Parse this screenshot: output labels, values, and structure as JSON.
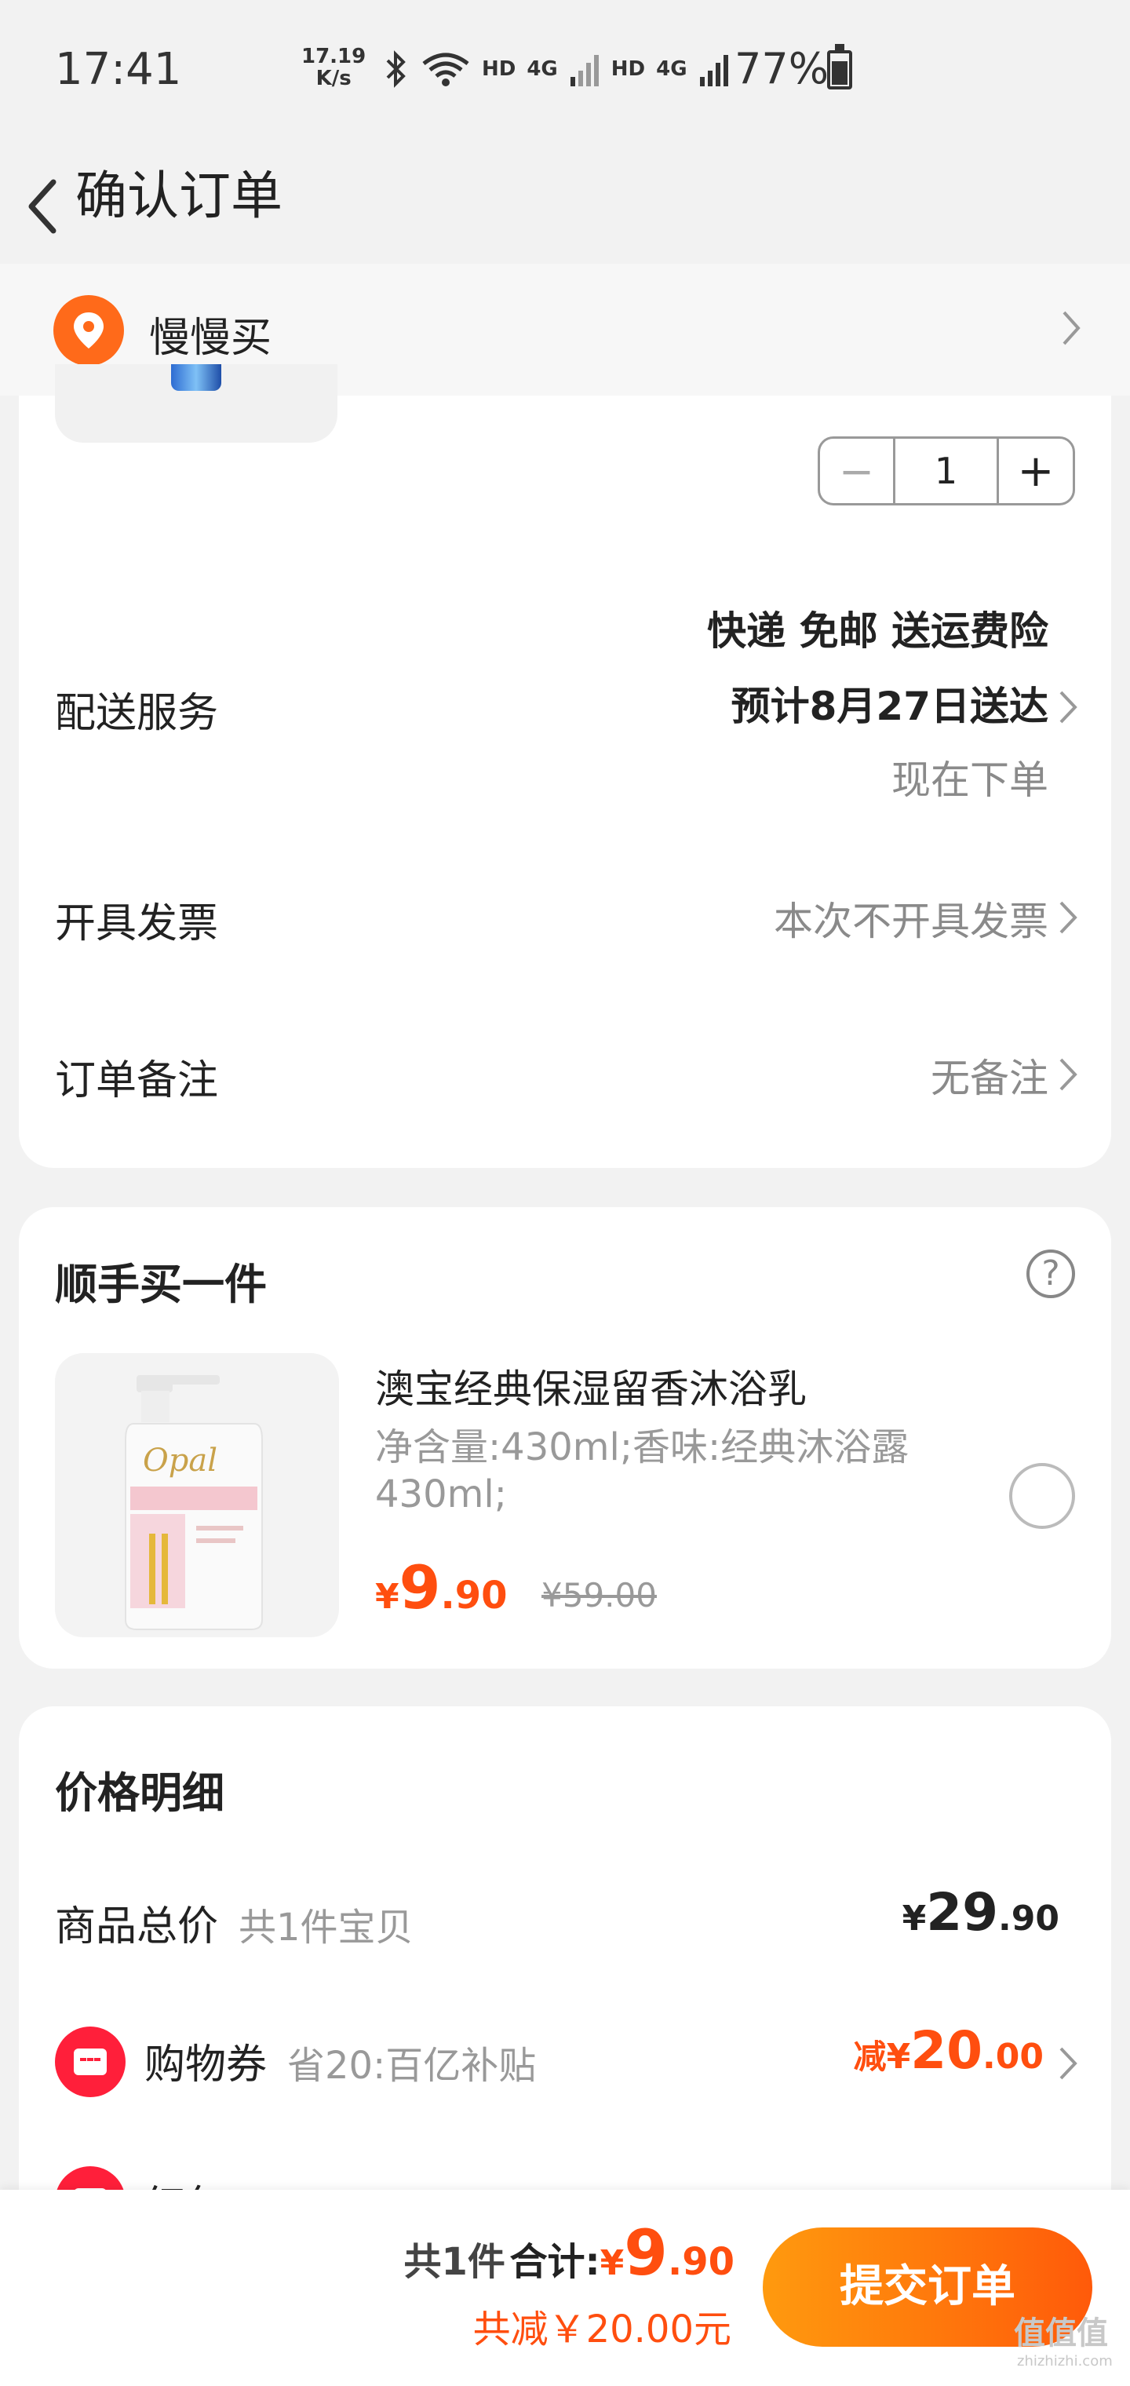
{
  "status_bar": {
    "time": "17:41",
    "net_speed_value": "17.19",
    "net_speed_unit": "K/s",
    "hd1": "HD",
    "net1": "4G",
    "hd2": "HD",
    "net2": "4G",
    "battery": "77%"
  },
  "nav": {
    "title": "确认订单"
  },
  "address": {
    "label": "慢慢买"
  },
  "item": {
    "quantity": "1",
    "minus": "−",
    "plus": "+"
  },
  "delivery": {
    "label": "配送服务",
    "line1": "快递 免邮 送运费险",
    "line2": "预计8月27日送达",
    "line3": "现在下单"
  },
  "invoice": {
    "label": "开具发票",
    "value": "本次不开具发票"
  },
  "remark": {
    "label": "订单备注",
    "value": "无备注"
  },
  "addon": {
    "title": "顺手买一件",
    "help": "?",
    "name": "澳宝经典保湿留香沐浴乳",
    "spec": "净含量:430ml;香味:经典沐浴露430ml;",
    "price_yen": "¥",
    "price_int": "9",
    "price_dec": ".90",
    "original": "¥59.00",
    "brand": "Opal"
  },
  "price_detail": {
    "title": "价格明细",
    "goods_label": "商品总价",
    "goods_note": "共1件宝贝",
    "goods_yen": "¥",
    "goods_int": "29",
    "goods_dec": ".90",
    "coupon_label": "购物券",
    "coupon_note": "省20:百亿补贴",
    "coupon_minus": "减",
    "coupon_yen": "¥",
    "coupon_int": "20",
    "coupon_dec": ".00",
    "redpacket_label": "红包"
  },
  "footer": {
    "count": "共1件",
    "total_label": "合计:",
    "total_yen": "¥",
    "total_int": "9",
    "total_dec": ".90",
    "saved": "共减￥20.00元",
    "submit": "提交订单",
    "watermark": "值值值",
    "watermark_sub": "zhizhizhi.com"
  },
  "colors": {
    "accent": "#ff4e0f",
    "button": "#ff6a0a",
    "coupon": "#ff1f3a",
    "background": "#f2f2f2"
  }
}
